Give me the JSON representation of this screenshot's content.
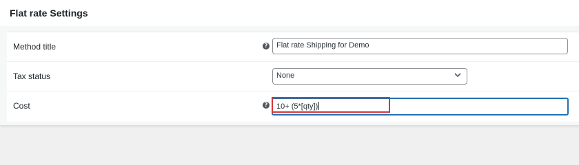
{
  "modal": {
    "title": "Flat rate Settings"
  },
  "fields": {
    "method_title": {
      "label": "Method title",
      "value": "Flat rate Shipping for Demo"
    },
    "tax_status": {
      "label": "Tax status",
      "selected": "None"
    },
    "cost": {
      "label": "Cost",
      "value": "10+ (5*[qty])"
    }
  },
  "colors": {
    "accent": "#2271b1",
    "annotation": "#d63638"
  },
  "icons": {
    "help": "help-tip-icon",
    "select_arrow": "chevron-down-icon"
  }
}
